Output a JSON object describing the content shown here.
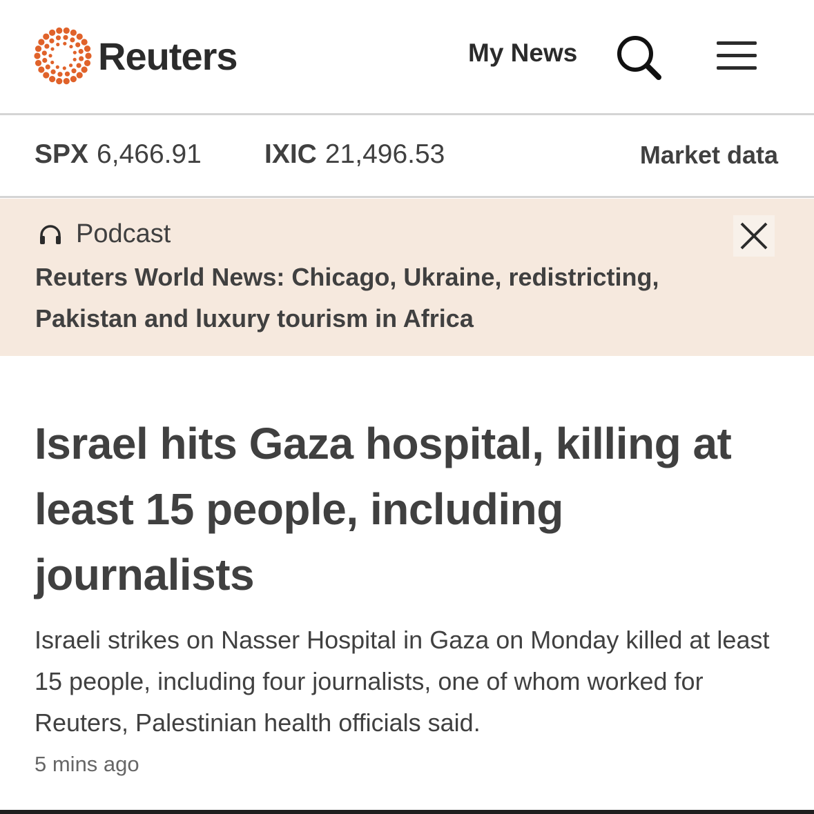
{
  "header": {
    "logo_text": "Reuters",
    "my_news_label": "My News",
    "search_icon": "search-icon",
    "menu_icon": "hamburger-menu-icon"
  },
  "market": {
    "tickers": [
      {
        "symbol": "SPX",
        "value": "6,466.91"
      },
      {
        "symbol": "IXIC",
        "value": "21,496.53"
      }
    ],
    "link_label": "Market data"
  },
  "podcast": {
    "icon": "headphones-icon",
    "label": "Podcast",
    "title": "Reuters World News: Chicago, Ukraine, redistricting, Pakistan and luxury tourism in Africa",
    "close_icon": "close-icon"
  },
  "article": {
    "headline": "Israel hits Gaza hospital, killing at least 15 people, including journalists",
    "summary": "Israeli strikes on Nasser Hospital in Gaza on Monday killed at least 15 people, including four journalists, one of whom worked for Reuters, Palestinian health officials said.",
    "timestamp": "5 mins ago"
  },
  "colors": {
    "logo_orange": "#e0622a",
    "podcast_bg": "#f6e9de",
    "text": "#404040"
  }
}
